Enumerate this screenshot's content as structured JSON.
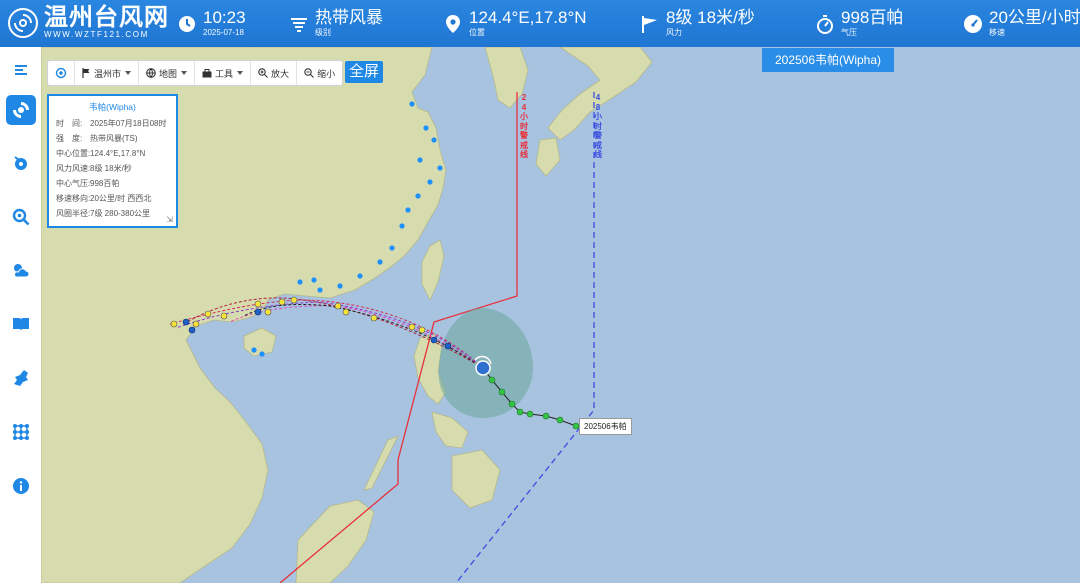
{
  "header": {
    "logo_title": "温州台风网",
    "logo_sub": "WWW.WZTF121.COM",
    "time": "10:23",
    "date": "2025-07-18",
    "level_value": "热带风暴",
    "level_label": "级别",
    "position_value": "124.4°E,17.8°N",
    "position_label": "位置",
    "wind_value": "8级 18米/秒",
    "wind_label": "风力",
    "pressure_value": "998百帕",
    "pressure_label": "气压",
    "speed_value": "20公里/小时",
    "speed_label": "移速"
  },
  "sidebar": {
    "items": [
      {
        "name": "list-icon"
      },
      {
        "name": "typhoon-icon",
        "active": true
      },
      {
        "name": "typhoon-path-icon"
      },
      {
        "name": "search-typhoon-icon"
      },
      {
        "name": "weather-icon"
      },
      {
        "name": "book-icon"
      },
      {
        "name": "region-map-icon"
      },
      {
        "name": "grid-network-icon"
      },
      {
        "name": "info-icon"
      }
    ]
  },
  "toolbar": {
    "city": "温州市",
    "map": "地图",
    "tools": "工具",
    "zoom_in": "放大",
    "zoom_out": "缩小",
    "fullscreen": "全屏"
  },
  "storm_tab": "202506韦帕(Wipha)",
  "info_panel": {
    "title": "韦帕(Wipha)",
    "rows": [
      {
        "k": "时　间:",
        "v": "2025年07月18日08时"
      },
      {
        "k": "强　度:",
        "v": "热带风暴(TS)"
      },
      {
        "k": "中心位置:",
        "v": "124.4°E,17.8°N"
      },
      {
        "k": "风力风速:",
        "v": "8级 18米/秒"
      },
      {
        "k": "中心气压:",
        "v": "998百帕"
      },
      {
        "k": "移速移向:",
        "v": "20公里/时 西西北"
      },
      {
        "k": "风圈半径:",
        "v": "7级 280-380公里"
      }
    ]
  },
  "map": {
    "storm_label": "202506韦帕",
    "warn24": "24小时警戒线",
    "warn48": "48小时警戒线"
  },
  "colors": {
    "header": "#1f76d2",
    "accent": "#1f88e5",
    "warn24": "#e8303a",
    "warn48": "#3a4de0",
    "past_track": "#33c244",
    "forecast_point": "#f4e23a",
    "station": "#1e90ff"
  }
}
